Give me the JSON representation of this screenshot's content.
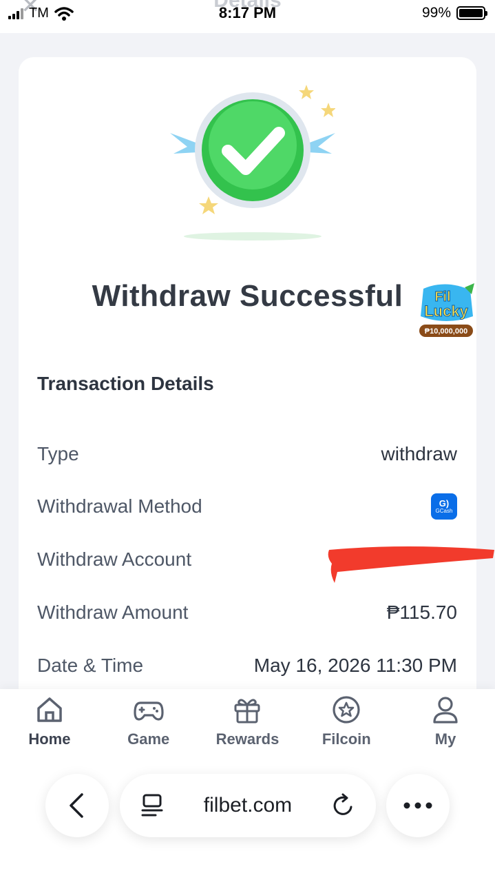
{
  "status_bar": {
    "carrier": "TM",
    "time": "8:17 PM",
    "battery": "99%",
    "battery_level": 0.99
  },
  "header": {
    "title": "Details"
  },
  "result": {
    "title": "Withdraw Successful",
    "promo_brand_line1": "Fil",
    "promo_brand_line2": "Lucky",
    "promo_amount": "₱10,000,000"
  },
  "transaction": {
    "section_title": "Transaction Details",
    "rows": [
      {
        "label": "Type",
        "value": "withdraw"
      },
      {
        "label": "Withdrawal Method",
        "value": "GCash"
      },
      {
        "label": "Withdraw Account",
        "value": ""
      },
      {
        "label": "Withdraw Amount",
        "value": "₱115.70"
      },
      {
        "label": "Date & Time",
        "value": "May 16, 2026 11:30 PM"
      }
    ]
  },
  "bottom_nav": {
    "items": [
      {
        "label": "Home",
        "icon": "home-icon"
      },
      {
        "label": "Game",
        "icon": "gamepad-icon"
      },
      {
        "label": "Rewards",
        "icon": "gift-icon"
      },
      {
        "label": "Filcoin",
        "icon": "coin-star-icon"
      },
      {
        "label": "My",
        "icon": "user-icon"
      }
    ]
  },
  "browser": {
    "url": "filbet.com"
  },
  "colors": {
    "success_green": "#33c24d",
    "gcash_blue": "#0a6ee8",
    "redaction_red": "#f23b2c"
  }
}
